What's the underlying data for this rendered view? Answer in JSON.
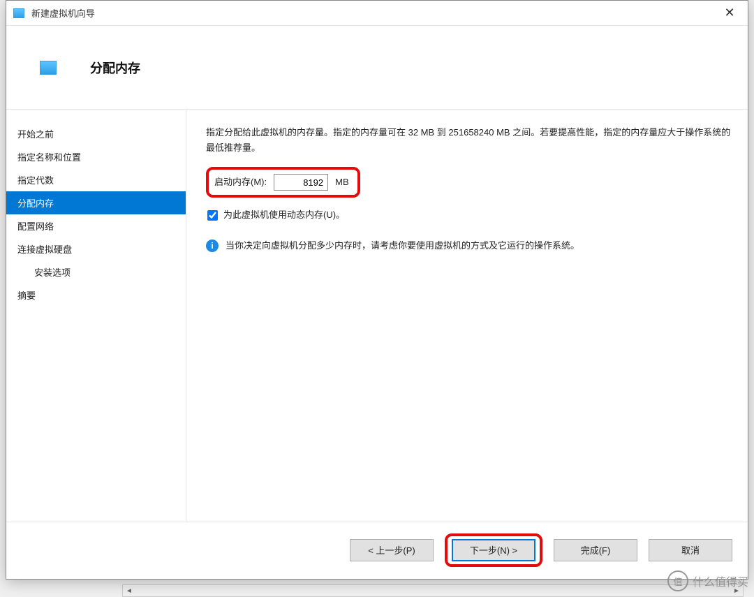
{
  "window": {
    "title": "新建虚拟机向导"
  },
  "header": {
    "page_title": "分配内存"
  },
  "sidebar": {
    "items": [
      {
        "label": "开始之前"
      },
      {
        "label": "指定名称和位置"
      },
      {
        "label": "指定代数"
      },
      {
        "label": "分配内存"
      },
      {
        "label": "配置网络"
      },
      {
        "label": "连接虚拟硬盘"
      },
      {
        "label": "安装选项"
      },
      {
        "label": "摘要"
      }
    ],
    "active_index": 3
  },
  "content": {
    "description": "指定分配给此虚拟机的内存量。指定的内存量可在 32 MB 到 251658240 MB 之间。若要提高性能，指定的内存量应大于操作系统的最低推荐量。",
    "mem_label": "启动内存(M):",
    "mem_value": "8192",
    "mem_unit": "MB",
    "dynamic_checkbox_label": "为此虚拟机使用动态内存(U)。",
    "dynamic_checked": true,
    "info_text": "当你决定向虚拟机分配多少内存时，请考虑你要使用虚拟机的方式及它运行的操作系统。"
  },
  "footer": {
    "prev": "< 上一步(P)",
    "next": "下一步(N) >",
    "finish": "完成(F)",
    "cancel": "取消"
  },
  "watermark": {
    "badge": "值",
    "text": "什么值得买"
  }
}
